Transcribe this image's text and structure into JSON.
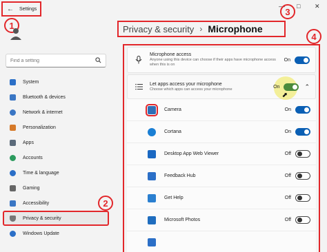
{
  "window": {
    "title": "Settings"
  },
  "badges": [
    "1",
    "2",
    "3",
    "4"
  ],
  "profile": {
    "name": "        ",
    "email": ""
  },
  "search": {
    "placeholder": "Find a setting"
  },
  "sidebar": {
    "items": [
      {
        "label": "System",
        "icon": "monitor-icon",
        "color": "#2b6fc7"
      },
      {
        "label": "Bluetooth & devices",
        "icon": "bluetooth-icon",
        "color": "#3a76c4"
      },
      {
        "label": "Network & internet",
        "icon": "network-icon",
        "color": "#3a76c4"
      },
      {
        "label": "Personalization",
        "icon": "brush-icon",
        "color": "#d67a2a"
      },
      {
        "label": "Apps",
        "icon": "apps-icon",
        "color": "#5b6a7a"
      },
      {
        "label": "Accounts",
        "icon": "accounts-icon",
        "color": "#2c9b5e"
      },
      {
        "label": "Time & language",
        "icon": "globe-clock-icon",
        "color": "#2b6fc7"
      },
      {
        "label": "Gaming",
        "icon": "gamepad-icon",
        "color": "#666666"
      },
      {
        "label": "Accessibility",
        "icon": "accessibility-icon",
        "color": "#3a76c4"
      },
      {
        "label": "Privacy & security",
        "icon": "shield-icon",
        "color": "#777777"
      },
      {
        "label": "Windows Update",
        "icon": "update-icon",
        "color": "#2b6fc7"
      }
    ]
  },
  "header": {
    "crumb": "Privacy & security",
    "separator": "›",
    "current": "Microphone"
  },
  "microphone_access": {
    "title": "Microphone access",
    "desc": "Anyone using this device can choose if their apps have microphone access when this is on",
    "state": "On"
  },
  "let_apps": {
    "title": "Let apps access your microphone",
    "desc": "Choose which apps can access your microphone",
    "state": "On"
  },
  "apps": [
    {
      "name": "Camera",
      "state": "On",
      "color": "#2f6fb6"
    },
    {
      "name": "Cortana",
      "state": "On",
      "color": "#1a7fd4"
    },
    {
      "name": "Desktop App Web Viewer",
      "state": "Off",
      "color": "#1a68c2"
    },
    {
      "name": "Feedback Hub",
      "state": "Off",
      "color": "#2b6fc7"
    },
    {
      "name": "Get Help",
      "state": "Off",
      "color": "#2a7fd0"
    },
    {
      "name": "Microsoft Photos",
      "state": "Off",
      "color": "#1f6dbf"
    },
    {
      "name": "",
      "state": "",
      "color": "#2b6fc7"
    }
  ],
  "colors": {
    "accent": "#0a5fb4",
    "annotation": "#e2262a"
  }
}
